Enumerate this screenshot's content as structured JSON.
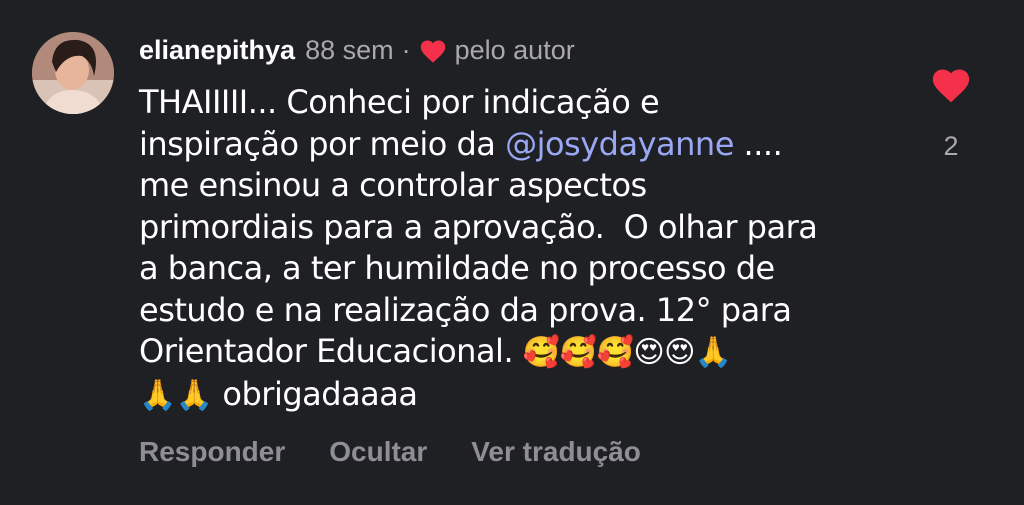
{
  "comment": {
    "username": "elianepithya",
    "time": "88 sem",
    "separator": "·",
    "liked_by_author_label": "pelo autor",
    "lines": [
      "THAIIIII... Conheci por indicação e",
      "inspiração por meio da ",
      "@josydayanne",
      " ....",
      "me ensinou a controlar aspectos",
      "primordiais para a aprovação.  O olhar para",
      "a banca, a ter humildade no processo de",
      "estudo e na realização da prova. 12° para",
      "Orientador Educacional. ",
      "🥰🥰🥰😍😍🙏",
      "🙏🙏",
      " obrigadaaaa"
    ],
    "like_count": "2"
  },
  "actions": {
    "reply": "Responder",
    "hide": "Ocultar",
    "translate": "Ver tradução"
  },
  "colors": {
    "background": "#1f2024",
    "heart": "#f5304a",
    "mention": "#9aa7f2",
    "muted": "#a8a8ad"
  },
  "icons": {
    "author_like": "heart-icon",
    "like": "heart-icon",
    "avatar": "avatar"
  }
}
